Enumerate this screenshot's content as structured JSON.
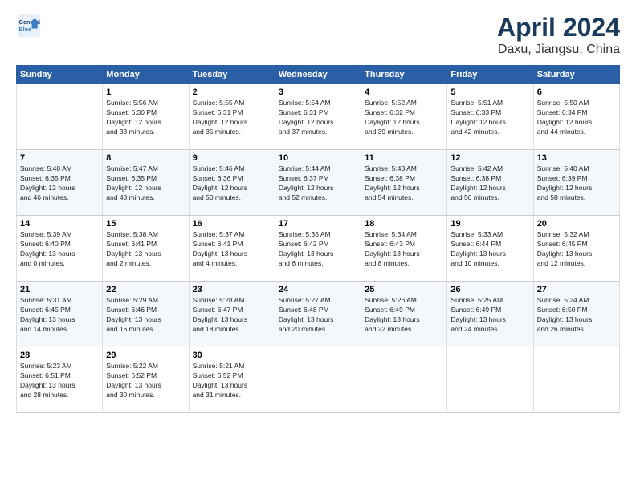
{
  "logo": {
    "line1": "General",
    "line2": "Blue"
  },
  "title": "April 2024",
  "subtitle": "Daxu, Jiangsu, China",
  "weekdays": [
    "Sunday",
    "Monday",
    "Tuesday",
    "Wednesday",
    "Thursday",
    "Friday",
    "Saturday"
  ],
  "weeks": [
    [
      {
        "num": "",
        "info": ""
      },
      {
        "num": "1",
        "info": "Sunrise: 5:56 AM\nSunset: 6:30 PM\nDaylight: 12 hours\nand 33 minutes."
      },
      {
        "num": "2",
        "info": "Sunrise: 5:55 AM\nSunset: 6:31 PM\nDaylight: 12 hours\nand 35 minutes."
      },
      {
        "num": "3",
        "info": "Sunrise: 5:54 AM\nSunset: 6:31 PM\nDaylight: 12 hours\nand 37 minutes."
      },
      {
        "num": "4",
        "info": "Sunrise: 5:52 AM\nSunset: 6:32 PM\nDaylight: 12 hours\nand 39 minutes."
      },
      {
        "num": "5",
        "info": "Sunrise: 5:51 AM\nSunset: 6:33 PM\nDaylight: 12 hours\nand 42 minutes."
      },
      {
        "num": "6",
        "info": "Sunrise: 5:50 AM\nSunset: 6:34 PM\nDaylight: 12 hours\nand 44 minutes."
      }
    ],
    [
      {
        "num": "7",
        "info": "Sunrise: 5:48 AM\nSunset: 6:35 PM\nDaylight: 12 hours\nand 46 minutes."
      },
      {
        "num": "8",
        "info": "Sunrise: 5:47 AM\nSunset: 6:35 PM\nDaylight: 12 hours\nand 48 minutes."
      },
      {
        "num": "9",
        "info": "Sunrise: 5:46 AM\nSunset: 6:36 PM\nDaylight: 12 hours\nand 50 minutes."
      },
      {
        "num": "10",
        "info": "Sunrise: 5:44 AM\nSunset: 6:37 PM\nDaylight: 12 hours\nand 52 minutes."
      },
      {
        "num": "11",
        "info": "Sunrise: 5:43 AM\nSunset: 6:38 PM\nDaylight: 12 hours\nand 54 minutes."
      },
      {
        "num": "12",
        "info": "Sunrise: 5:42 AM\nSunset: 6:38 PM\nDaylight: 12 hours\nand 56 minutes."
      },
      {
        "num": "13",
        "info": "Sunrise: 5:40 AM\nSunset: 6:39 PM\nDaylight: 12 hours\nand 58 minutes."
      }
    ],
    [
      {
        "num": "14",
        "info": "Sunrise: 5:39 AM\nSunset: 6:40 PM\nDaylight: 13 hours\nand 0 minutes."
      },
      {
        "num": "15",
        "info": "Sunrise: 5:38 AM\nSunset: 6:41 PM\nDaylight: 13 hours\nand 2 minutes."
      },
      {
        "num": "16",
        "info": "Sunrise: 5:37 AM\nSunset: 6:41 PM\nDaylight: 13 hours\nand 4 minutes."
      },
      {
        "num": "17",
        "info": "Sunrise: 5:35 AM\nSunset: 6:42 PM\nDaylight: 13 hours\nand 6 minutes."
      },
      {
        "num": "18",
        "info": "Sunrise: 5:34 AM\nSunset: 6:43 PM\nDaylight: 13 hours\nand 8 minutes."
      },
      {
        "num": "19",
        "info": "Sunrise: 5:33 AM\nSunset: 6:44 PM\nDaylight: 13 hours\nand 10 minutes."
      },
      {
        "num": "20",
        "info": "Sunrise: 5:32 AM\nSunset: 6:45 PM\nDaylight: 13 hours\nand 12 minutes."
      }
    ],
    [
      {
        "num": "21",
        "info": "Sunrise: 5:31 AM\nSunset: 6:45 PM\nDaylight: 13 hours\nand 14 minutes."
      },
      {
        "num": "22",
        "info": "Sunrise: 5:29 AM\nSunset: 6:46 PM\nDaylight: 13 hours\nand 16 minutes."
      },
      {
        "num": "23",
        "info": "Sunrise: 5:28 AM\nSunset: 6:47 PM\nDaylight: 13 hours\nand 18 minutes."
      },
      {
        "num": "24",
        "info": "Sunrise: 5:27 AM\nSunset: 6:48 PM\nDaylight: 13 hours\nand 20 minutes."
      },
      {
        "num": "25",
        "info": "Sunrise: 5:26 AM\nSunset: 6:49 PM\nDaylight: 13 hours\nand 22 minutes."
      },
      {
        "num": "26",
        "info": "Sunrise: 5:25 AM\nSunset: 6:49 PM\nDaylight: 13 hours\nand 24 minutes."
      },
      {
        "num": "27",
        "info": "Sunrise: 5:24 AM\nSunset: 6:50 PM\nDaylight: 13 hours\nand 26 minutes."
      }
    ],
    [
      {
        "num": "28",
        "info": "Sunrise: 5:23 AM\nSunset: 6:51 PM\nDaylight: 13 hours\nand 28 minutes."
      },
      {
        "num": "29",
        "info": "Sunrise: 5:22 AM\nSunset: 6:52 PM\nDaylight: 13 hours\nand 30 minutes."
      },
      {
        "num": "30",
        "info": "Sunrise: 5:21 AM\nSunset: 6:52 PM\nDaylight: 13 hours\nand 31 minutes."
      },
      {
        "num": "",
        "info": ""
      },
      {
        "num": "",
        "info": ""
      },
      {
        "num": "",
        "info": ""
      },
      {
        "num": "",
        "info": ""
      }
    ]
  ]
}
